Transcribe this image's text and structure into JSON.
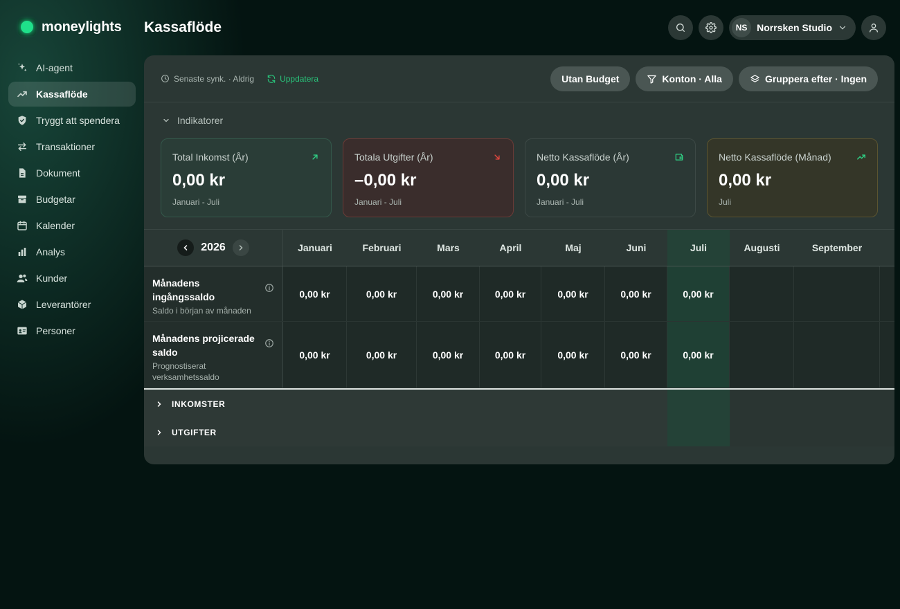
{
  "brand": {
    "name": "moneylights"
  },
  "page": {
    "title": "Kassaflöde"
  },
  "nav": [
    {
      "label": "AI-agent",
      "icon": "sparkles-icon",
      "active": false
    },
    {
      "label": "Kassaflöde",
      "icon": "trend-up-icon",
      "active": true
    },
    {
      "label": "Tryggt att spendera",
      "icon": "shield-check-icon",
      "active": false
    },
    {
      "label": "Transaktioner",
      "icon": "arrows-swap-icon",
      "active": false
    },
    {
      "label": "Dokument",
      "icon": "document-icon",
      "active": false
    },
    {
      "label": "Budgetar",
      "icon": "archive-box-icon",
      "active": false
    },
    {
      "label": "Kalender",
      "icon": "calendar-icon",
      "active": false
    },
    {
      "label": "Analys",
      "icon": "bar-chart-icon",
      "active": false
    },
    {
      "label": "Kunder",
      "icon": "users-icon",
      "active": false
    },
    {
      "label": "Leverantörer",
      "icon": "cube-icon",
      "active": false
    },
    {
      "label": "Personer",
      "icon": "id-card-icon",
      "active": false
    }
  ],
  "topbar": {
    "org_initials": "NS",
    "org_name": "Norrsken Studio"
  },
  "toolbar": {
    "sync_status": "Senaste synk. · Aldrig",
    "update_label": "Uppdatera",
    "budget_filter": "Utan Budget",
    "accounts_filter": "Konton · Alla",
    "group_filter": "Gruppera efter · Ingen"
  },
  "indicators": {
    "heading": "Indikatorer",
    "cards": [
      {
        "title": "Total Inkomst (År)",
        "value": "0,00 kr",
        "period": "Januari - Juli",
        "icon": "arrow-up-right-icon",
        "icon_color": "#2fcf84"
      },
      {
        "title": "Totala Utgifter (År)",
        "value": "–0,00 kr",
        "period": "Januari - Juli",
        "icon": "arrow-down-right-icon",
        "icon_color": "#e0463e"
      },
      {
        "title": "Netto Kassaflöde (År)",
        "value": "0,00 kr",
        "period": "Januari - Juli",
        "icon": "wallet-icon",
        "icon_color": "#2fcf84"
      },
      {
        "title": "Netto Kassaflöde (Månad)",
        "value": "0,00 kr",
        "period": "Juli",
        "icon": "trend-up-icon",
        "icon_color": "#2fcf84"
      }
    ]
  },
  "grid": {
    "year": "2026",
    "current_month_index": 6,
    "months": [
      "Januari",
      "Februari",
      "Mars",
      "April",
      "Maj",
      "Juni",
      "Juli",
      "Augusti",
      "September"
    ],
    "rows": [
      {
        "title": "Månadens ingångssaldo",
        "subtitle": "Saldo i början av månaden",
        "values": [
          "0,00 kr",
          "0,00 kr",
          "0,00 kr",
          "0,00 kr",
          "0,00 kr",
          "0,00 kr",
          "0,00 kr",
          "",
          ""
        ]
      },
      {
        "title": "Månadens projicerade saldo",
        "subtitle": "Prognostiserat verksamhetssaldo",
        "values": [
          "0,00 kr",
          "0,00 kr",
          "0,00 kr",
          "0,00 kr",
          "0,00 kr",
          "0,00 kr",
          "0,00 kr",
          "",
          ""
        ]
      }
    ],
    "sections": [
      "INKOMSTER",
      "UTGIFTER"
    ]
  }
}
